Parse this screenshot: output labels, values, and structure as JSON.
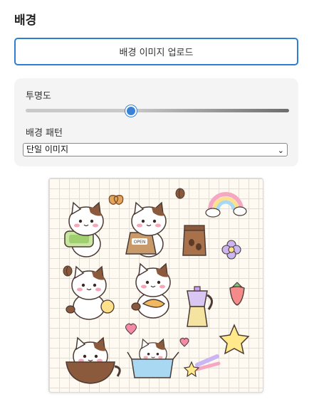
{
  "section": {
    "title": "배경"
  },
  "upload": {
    "label": "배경 이미지 업로드"
  },
  "opacity": {
    "label": "투명도",
    "value": 0.4
  },
  "pattern": {
    "label": "배경 패턴",
    "selected": "단일 이미지"
  },
  "preview": {
    "sign_text": "OPEN",
    "colors": {
      "accent": "#3b82d6",
      "grid": "#f1d9c8",
      "paper": "#fffaf1"
    },
    "stickers": [
      "cat-icon",
      "pretzel-icon",
      "coffee-bean-icon",
      "rainbow-icon",
      "coffee-bag-icon",
      "flower-icon",
      "strawberry-icon",
      "moka-pot-icon",
      "heart-icon",
      "star-icon",
      "shooting-star-icon",
      "coffee-cup-icon",
      "box-icon"
    ]
  }
}
